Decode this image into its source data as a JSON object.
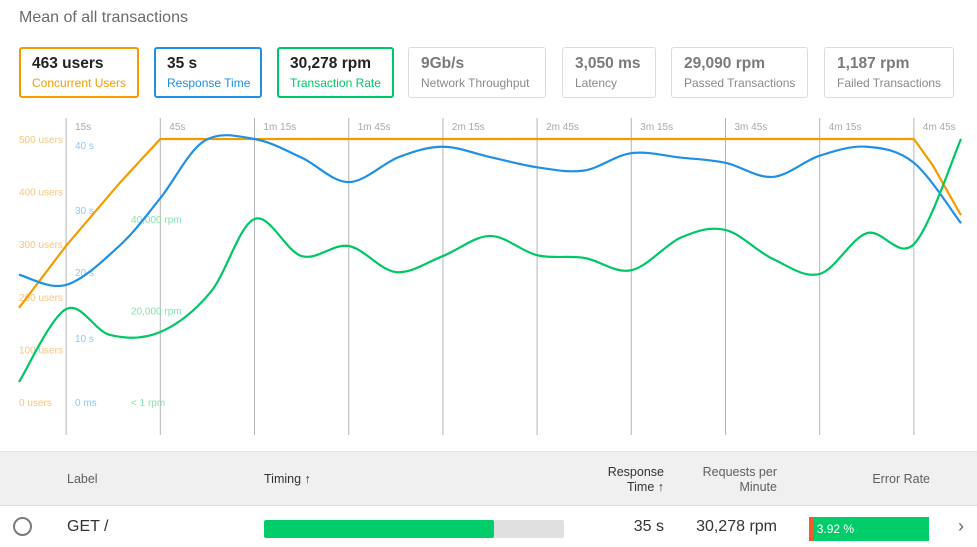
{
  "page": {
    "title": "Mean of all transactions"
  },
  "cards": [
    {
      "value": "463 users",
      "label": "Concurrent Users",
      "active": true,
      "color": "#f59b00"
    },
    {
      "value": "35 s",
      "label": "Response Time",
      "active": true,
      "color": "#1e90e6"
    },
    {
      "value": "30,278 rpm",
      "label": "Transaction Rate",
      "active": true,
      "color": "#00c765"
    },
    {
      "value": "9Gb/s",
      "label": "Network Throughput",
      "active": false
    },
    {
      "value": "3,050 ms",
      "label": "Latency",
      "active": false
    },
    {
      "value": "29,090 rpm",
      "label": "Passed Transactions",
      "active": false
    },
    {
      "value": "1,187 rpm",
      "label": "Failed Transactions",
      "active": false
    }
  ],
  "chart_data": {
    "type": "line",
    "title": "Mean of all transactions",
    "xlabel": "",
    "x_unit": "seconds",
    "xlim": [
      0,
      300
    ],
    "x_ticks": [
      {
        "t": 15,
        "label": "15s"
      },
      {
        "t": 45,
        "label": "45s"
      },
      {
        "t": 75,
        "label": "1m 15s"
      },
      {
        "t": 105,
        "label": "1m 45s"
      },
      {
        "t": 135,
        "label": "2m 15s"
      },
      {
        "t": 165,
        "label": "2m 45s"
      },
      {
        "t": 195,
        "label": "3m 15s"
      },
      {
        "t": 225,
        "label": "3m 45s"
      },
      {
        "t": 255,
        "label": "4m 15s"
      },
      {
        "t": 285,
        "label": "4m 45s"
      }
    ],
    "grid": "vertical",
    "axes": [
      {
        "name": "users",
        "color": "#f59b00",
        "ylim": [
          0,
          500
        ],
        "ticks": [
          {
            "v": 0,
            "label": "0 users"
          },
          {
            "v": 100,
            "label": "100 users"
          },
          {
            "v": 200,
            "label": "200 users"
          },
          {
            "v": 300,
            "label": "300 users"
          },
          {
            "v": 400,
            "label": "400 users"
          },
          {
            "v": 500,
            "label": "500 users"
          }
        ]
      },
      {
        "name": "response",
        "color": "#1e90e6",
        "ylim": [
          0,
          41
        ],
        "ticks": [
          {
            "v": 0,
            "label": "0 ms"
          },
          {
            "v": 10,
            "label": "10 s"
          },
          {
            "v": 20,
            "label": "20 s"
          },
          {
            "v": 30,
            "label": "30 s"
          },
          {
            "v": 40,
            "label": "40 s"
          }
        ]
      },
      {
        "name": "rpm",
        "color": "#00c765",
        "ylim": [
          0,
          57500
        ],
        "ticks": [
          {
            "v": 0,
            "label": "< 1 rpm"
          },
          {
            "v": 20000,
            "label": "20,000 rpm"
          },
          {
            "v": 40000,
            "label": "40,000 rpm"
          }
        ]
      }
    ],
    "series": [
      {
        "name": "Concurrent Users",
        "axis": "users",
        "color": "#f59b00",
        "x": [
          0,
          15,
          32,
          45,
          285,
          291,
          300
        ],
        "y": [
          179,
          297,
          416,
          500,
          500,
          450,
          355
        ]
      },
      {
        "name": "Response Time",
        "axis": "response",
        "color": "#1e90e6",
        "x": [
          0,
          15,
          32,
          45,
          59,
          75,
          90,
          105,
          121,
          135,
          150,
          165,
          180,
          195,
          211,
          225,
          240,
          255,
          270,
          285,
          300
        ],
        "y": [
          19.8,
          18.2,
          24.3,
          31.7,
          40.6,
          40.9,
          38.0,
          34.2,
          38.1,
          39.7,
          38.1,
          36.5,
          36.0,
          38.7,
          38.0,
          37.2,
          35.0,
          38.3,
          39.7,
          37.2,
          27.8
        ]
      },
      {
        "name": "Transaction Rate",
        "axis": "rpm",
        "color": "#00c765",
        "x": [
          0,
          15,
          29,
          45,
          61,
          75,
          90,
          105,
          120,
          135,
          150,
          165,
          180,
          195,
          211,
          225,
          240,
          255,
          270,
          285,
          300
        ],
        "y": [
          4370,
          20300,
          14650,
          15300,
          24000,
          40000,
          31900,
          34100,
          28400,
          31900,
          36300,
          32100,
          31500,
          28800,
          36000,
          37600,
          31300,
          28000,
          36900,
          34500,
          57500
        ]
      }
    ]
  },
  "table": {
    "headers": {
      "label": "Label",
      "timing": "Timing ↑",
      "response_1": "Response",
      "response_2": "Time ↑",
      "rpm_1": "Requests per",
      "rpm_2": "Minute",
      "error": "Error Rate"
    },
    "rows": [
      {
        "label": "GET /",
        "timing_fraction": 0.765,
        "response_time": "35 s",
        "rpm": "30,278 rpm",
        "error_rate": "3.92 %",
        "error_fraction": 0.0392
      }
    ]
  }
}
